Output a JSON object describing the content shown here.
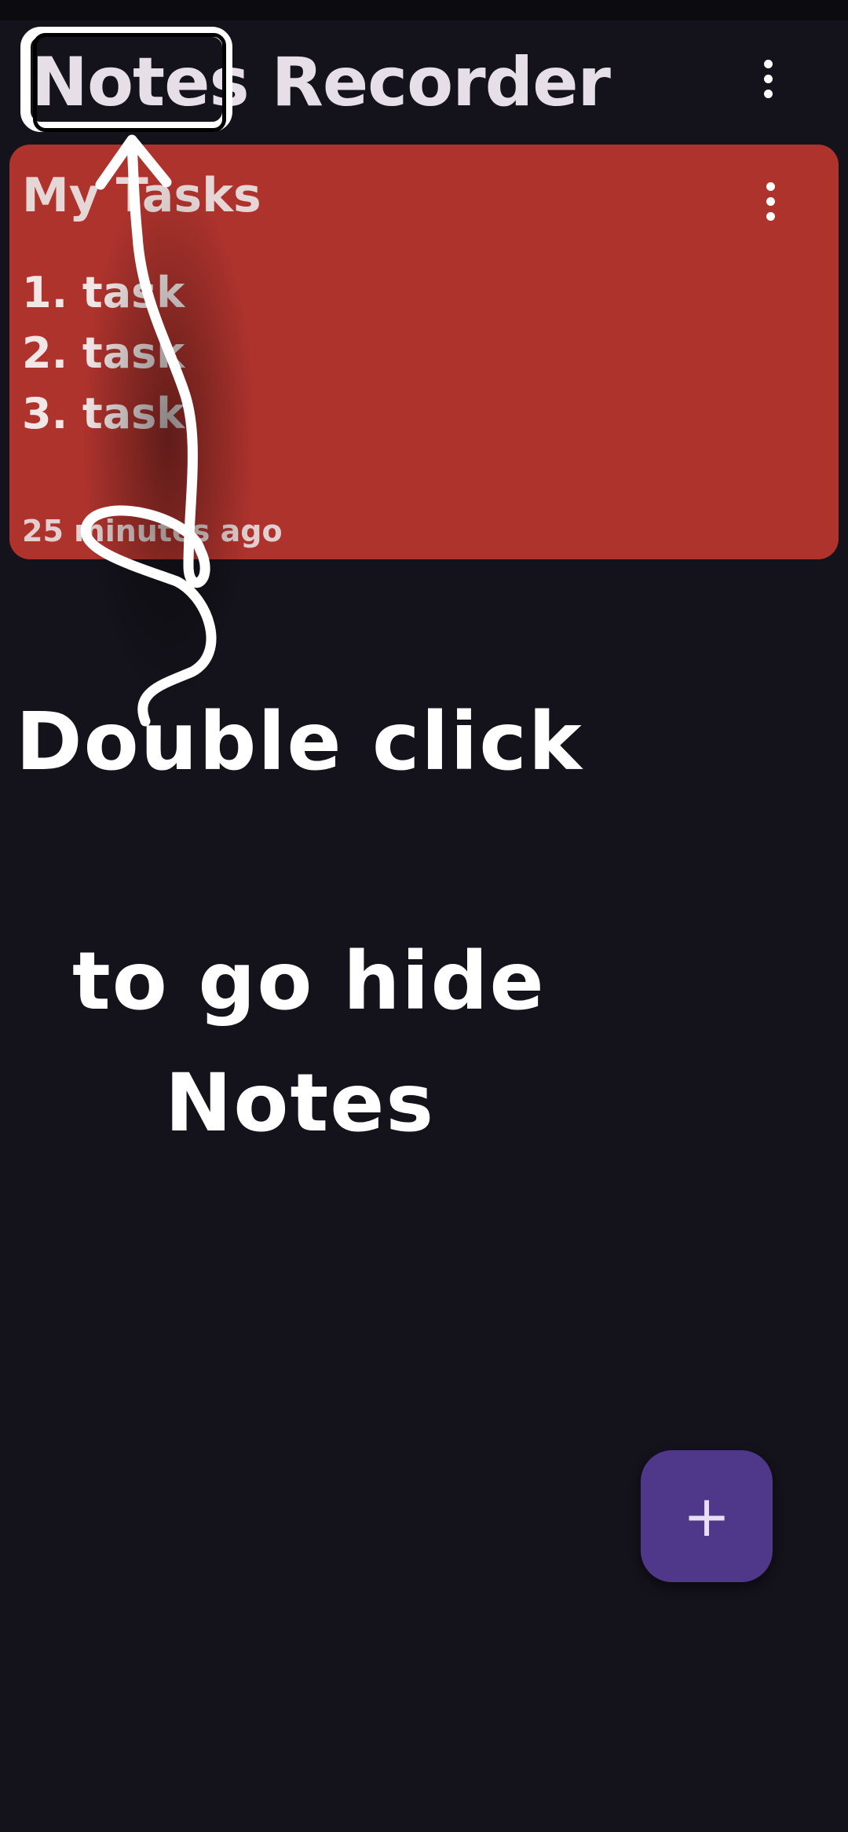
{
  "app": {
    "title": "Notes Recorder",
    "menu_icon": "more-vert-icon"
  },
  "notes": [
    {
      "title": "My Tasks",
      "lines": [
        "1. task",
        "2. task",
        "3. task"
      ],
      "timestamp": "25 minutes ago",
      "menu_icon": "more-vert-icon",
      "color": "#ae332d"
    }
  ],
  "annotation": {
    "line1": "Double click",
    "line2": "to go hide",
    "line3": "Notes"
  },
  "fab": {
    "icon": "plus-icon",
    "glyph": "+",
    "color": "#4f378a"
  },
  "colors": {
    "background": "#14121a",
    "card": "#ae332d",
    "accent": "#4f378a"
  }
}
